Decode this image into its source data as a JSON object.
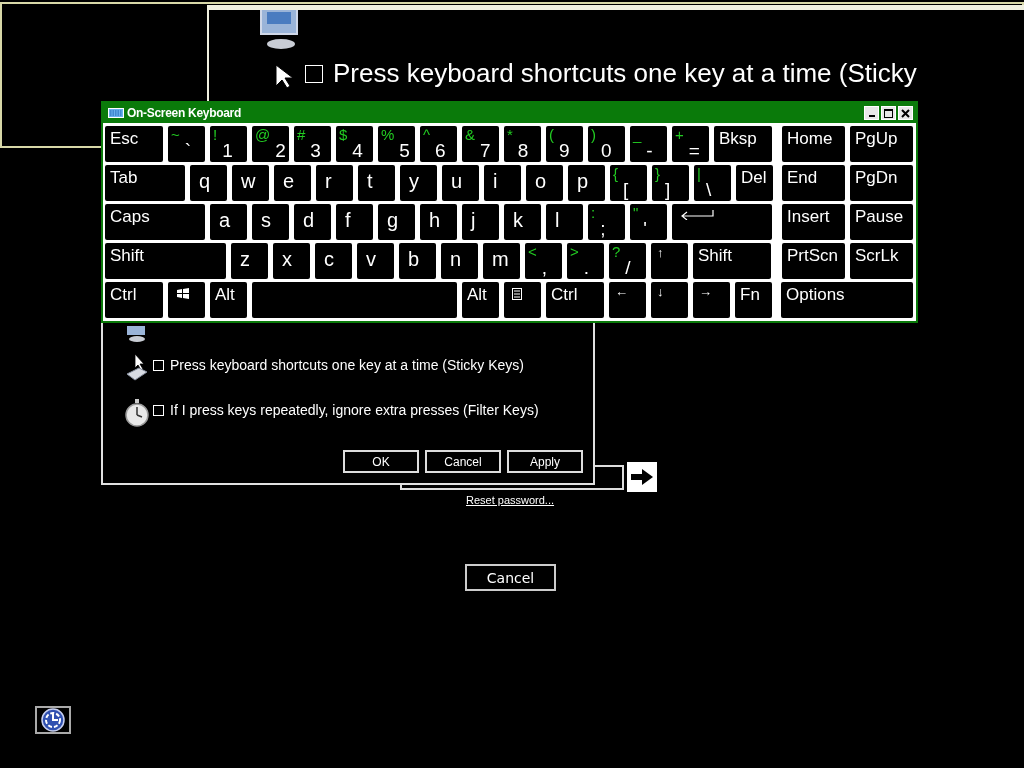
{
  "magnifier": {
    "option": {
      "text": "Press keyboard shortcuts one key at a time (Sticky",
      "checked": false
    }
  },
  "keyboard": {
    "title": "On-Screen Keyboard",
    "rows": [
      {
        "keys": [
          {
            "kind": "name",
            "label": "Esc"
          },
          {
            "kind": "char",
            "label": "`",
            "shift": "~"
          },
          {
            "kind": "char",
            "label": "1",
            "shift": "!"
          },
          {
            "kind": "char",
            "label": "2",
            "shift": "@"
          },
          {
            "kind": "char",
            "label": "3",
            "shift": "#"
          },
          {
            "kind": "char",
            "label": "4",
            "shift": "$"
          },
          {
            "kind": "char",
            "label": "5",
            "shift": "%"
          },
          {
            "kind": "char",
            "label": "6",
            "shift": "^"
          },
          {
            "kind": "char",
            "label": "7",
            "shift": "&"
          },
          {
            "kind": "char",
            "label": "8",
            "shift": "*"
          },
          {
            "kind": "char",
            "label": "9",
            "shift": "("
          },
          {
            "kind": "char",
            "label": "0",
            "shift": ")"
          },
          {
            "kind": "char",
            "label": "-",
            "shift": "_"
          },
          {
            "kind": "char",
            "label": "=",
            "shift": "+"
          },
          {
            "kind": "name",
            "label": "Bksp"
          }
        ],
        "nav_keys": [
          {
            "label": "Home"
          },
          {
            "label": "PgUp"
          }
        ]
      },
      {
        "keys": [
          {
            "kind": "name",
            "label": "Tab"
          },
          {
            "kind": "char",
            "label": "q"
          },
          {
            "kind": "char",
            "label": "w"
          },
          {
            "kind": "char",
            "label": "e"
          },
          {
            "kind": "char",
            "label": "r"
          },
          {
            "kind": "char",
            "label": "t"
          },
          {
            "kind": "char",
            "label": "y"
          },
          {
            "kind": "char",
            "label": "u"
          },
          {
            "kind": "char",
            "label": "i"
          },
          {
            "kind": "char",
            "label": "o"
          },
          {
            "kind": "char",
            "label": "p"
          },
          {
            "kind": "char",
            "label": "[",
            "shift": "{"
          },
          {
            "kind": "char",
            "label": "]",
            "shift": "}"
          },
          {
            "kind": "char",
            "label": "\\",
            "shift": "|"
          },
          {
            "kind": "name",
            "label": "Del"
          }
        ],
        "nav_keys": [
          {
            "label": "End"
          },
          {
            "label": "PgDn"
          }
        ]
      },
      {
        "keys": [
          {
            "kind": "name",
            "label": "Caps"
          },
          {
            "kind": "char",
            "label": "a"
          },
          {
            "kind": "char",
            "label": "s"
          },
          {
            "kind": "char",
            "label": "d"
          },
          {
            "kind": "char",
            "label": "f"
          },
          {
            "kind": "char",
            "label": "g"
          },
          {
            "kind": "char",
            "label": "h"
          },
          {
            "kind": "char",
            "label": "j"
          },
          {
            "kind": "char",
            "label": "k"
          },
          {
            "kind": "char",
            "label": "l"
          },
          {
            "kind": "char",
            "label": ";",
            "shift": ":"
          },
          {
            "kind": "char",
            "label": "'",
            "shift": "\""
          },
          {
            "kind": "enter"
          }
        ],
        "nav_keys": [
          {
            "label": "Insert"
          },
          {
            "label": "Pause"
          }
        ]
      },
      {
        "keys": [
          {
            "kind": "name",
            "label": "Shift"
          },
          {
            "kind": "char",
            "label": "z"
          },
          {
            "kind": "char",
            "label": "x"
          },
          {
            "kind": "char",
            "label": "c"
          },
          {
            "kind": "char",
            "label": "v"
          },
          {
            "kind": "char",
            "label": "b"
          },
          {
            "kind": "char",
            "label": "n"
          },
          {
            "kind": "char",
            "label": "m"
          },
          {
            "kind": "char",
            "label": ",",
            "shift": "<"
          },
          {
            "kind": "char",
            "label": ".",
            "shift": ">"
          },
          {
            "kind": "char",
            "label": "/",
            "shift": "?"
          },
          {
            "kind": "arrow",
            "label": "↑"
          },
          {
            "kind": "name",
            "label": "Shift"
          }
        ],
        "nav_keys": [
          {
            "label": "PrtScn"
          },
          {
            "label": "ScrLk"
          }
        ]
      },
      {
        "keys": [
          {
            "kind": "name",
            "label": "Ctrl"
          },
          {
            "kind": "windows"
          },
          {
            "kind": "name",
            "label": "Alt"
          },
          {
            "kind": "space"
          },
          {
            "kind": "name",
            "label": "Alt"
          },
          {
            "kind": "menu"
          },
          {
            "kind": "name",
            "label": "Ctrl"
          },
          {
            "kind": "arrow",
            "label": "←"
          },
          {
            "kind": "arrow",
            "label": "↓"
          },
          {
            "kind": "arrow",
            "label": "→"
          },
          {
            "kind": "name",
            "label": "Fn"
          }
        ],
        "nav_keys": [
          {
            "label": "Options"
          }
        ]
      }
    ]
  },
  "dialog": {
    "options": [
      {
        "text": "Press keyboard shortcuts one key at a time (Sticky Keys)",
        "checked": false
      },
      {
        "text": "If I press keys repeatedly, ignore extra presses (Filter Keys)",
        "checked": false
      }
    ],
    "buttons": [
      "OK",
      "Cancel",
      "Apply"
    ]
  },
  "logon": {
    "reset_link": "Reset password...",
    "cancel_button": "Cancel"
  }
}
